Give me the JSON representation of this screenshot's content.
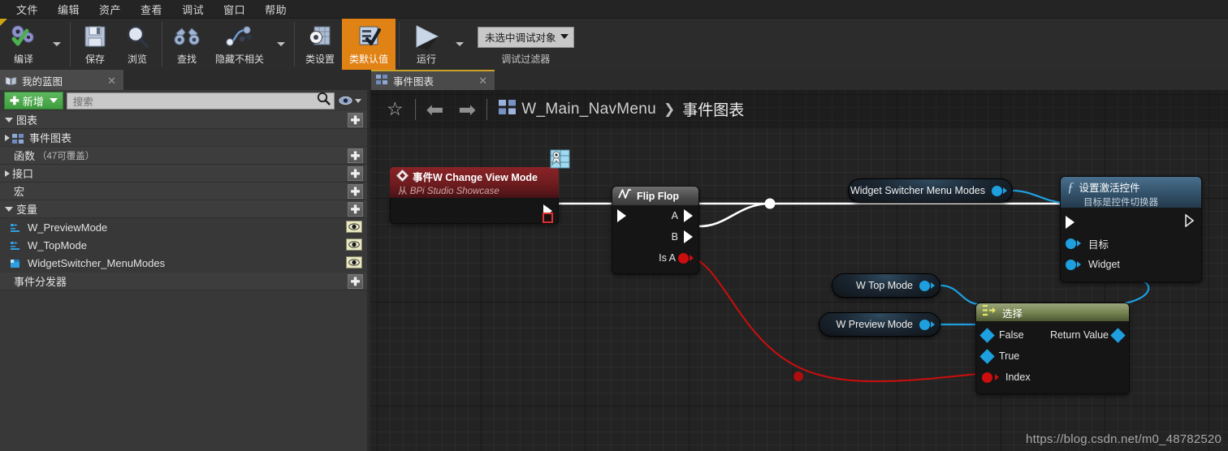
{
  "menubar": {
    "items": [
      {
        "label": "文件",
        "name": "menu-file"
      },
      {
        "label": "编辑",
        "name": "menu-edit"
      },
      {
        "label": "资产",
        "name": "menu-asset"
      },
      {
        "label": "查看",
        "name": "menu-view"
      },
      {
        "label": "调试",
        "name": "menu-debug"
      },
      {
        "label": "窗口",
        "name": "menu-window"
      },
      {
        "label": "帮助",
        "name": "menu-help"
      }
    ]
  },
  "toolbar": {
    "compile_label": "编译",
    "save_label": "保存",
    "browse_label": "浏览",
    "find_label": "查找",
    "hide_unrelated_label": "隐藏不相关",
    "class_settings_label": "类设置",
    "class_defaults_label": "类默认值",
    "play_label": "运行",
    "debug_object_value": "未选中调试对象",
    "debug_filter_label": "调试过滤器"
  },
  "left_panel": {
    "tab_label": "我的蓝图",
    "tab_close": "✕",
    "add_button_label": "新增",
    "search_placeholder": "搜索",
    "sections": [
      {
        "label": "图表",
        "name": "section-graphs",
        "expanded": true,
        "has_plus": true
      },
      {
        "label": "事件图表",
        "name": "section-event-graph",
        "expanded": false,
        "is_child": true
      },
      {
        "label": "函数",
        "sub": "（47可覆盖）",
        "name": "section-functions",
        "has_plus": true
      },
      {
        "label": "接口",
        "name": "section-interfaces",
        "expanded": false,
        "has_plus": true
      },
      {
        "label": "宏",
        "name": "section-macros",
        "has_plus": true
      },
      {
        "label": "变量",
        "name": "section-variables",
        "expanded": true,
        "has_plus": true
      }
    ],
    "variables": [
      {
        "label": "W_PreviewMode",
        "name": "variable-w-previewmode",
        "icon": "object-ref-icon"
      },
      {
        "label": "W_TopMode",
        "name": "variable-w-topmode",
        "icon": "object-ref-icon"
      },
      {
        "label": "WidgetSwitcher_MenuModes",
        "name": "variable-widgetswitcher-menumodes",
        "icon": "widget-ref-icon"
      }
    ],
    "event_dispatchers_label": "事件分发器"
  },
  "graph": {
    "tab_label": "事件图表",
    "tab_close": "✕",
    "breadcrumb": {
      "blueprint_name": "W_Main_NavMenu",
      "separator": "❯",
      "current": "事件图表"
    },
    "nodes": {
      "event": {
        "title": "事件W Change View Mode",
        "subtitle_prefix": "从",
        "subtitle": "BPi Studio Showcase",
        "name": "node-event-w-change-view-mode"
      },
      "flipflop": {
        "title": "Flip Flop",
        "pin_a": "A",
        "pin_b": "B",
        "pin_is_a": "Is A",
        "name": "node-flip-flop"
      },
      "set_active_widget": {
        "title": "设置激活控件",
        "subtitle": "目标是控件切换器",
        "pin_target": "目标",
        "pin_widget": "Widget",
        "name": "node-set-active-widget"
      },
      "select": {
        "title": "选择",
        "pin_false": "False",
        "pin_true": "True",
        "pin_index": "Index",
        "pin_return": "Return Value",
        "name": "node-select"
      },
      "get_widget_switcher": {
        "label": "Widget Switcher Menu Modes",
        "name": "node-get-widget-switcher-menu-modes"
      },
      "get_w_top_mode": {
        "label": "W Top Mode",
        "name": "node-get-w-top-mode"
      },
      "get_w_preview_mode": {
        "label": "W Preview Mode",
        "name": "node-get-w-preview-mode"
      }
    }
  },
  "watermark": "https://blog.csdn.net/m0_48782520",
  "colors": {
    "accent_orange": "#e08214",
    "exec_wire": "#ffffff",
    "bool_wire": "#cc0e0e",
    "object_wire": "#1e9fe0",
    "tab_accent": "#c9a227",
    "event_node": "#6d1c1f",
    "function_node": "#34546d",
    "select_node": "#73804f"
  }
}
